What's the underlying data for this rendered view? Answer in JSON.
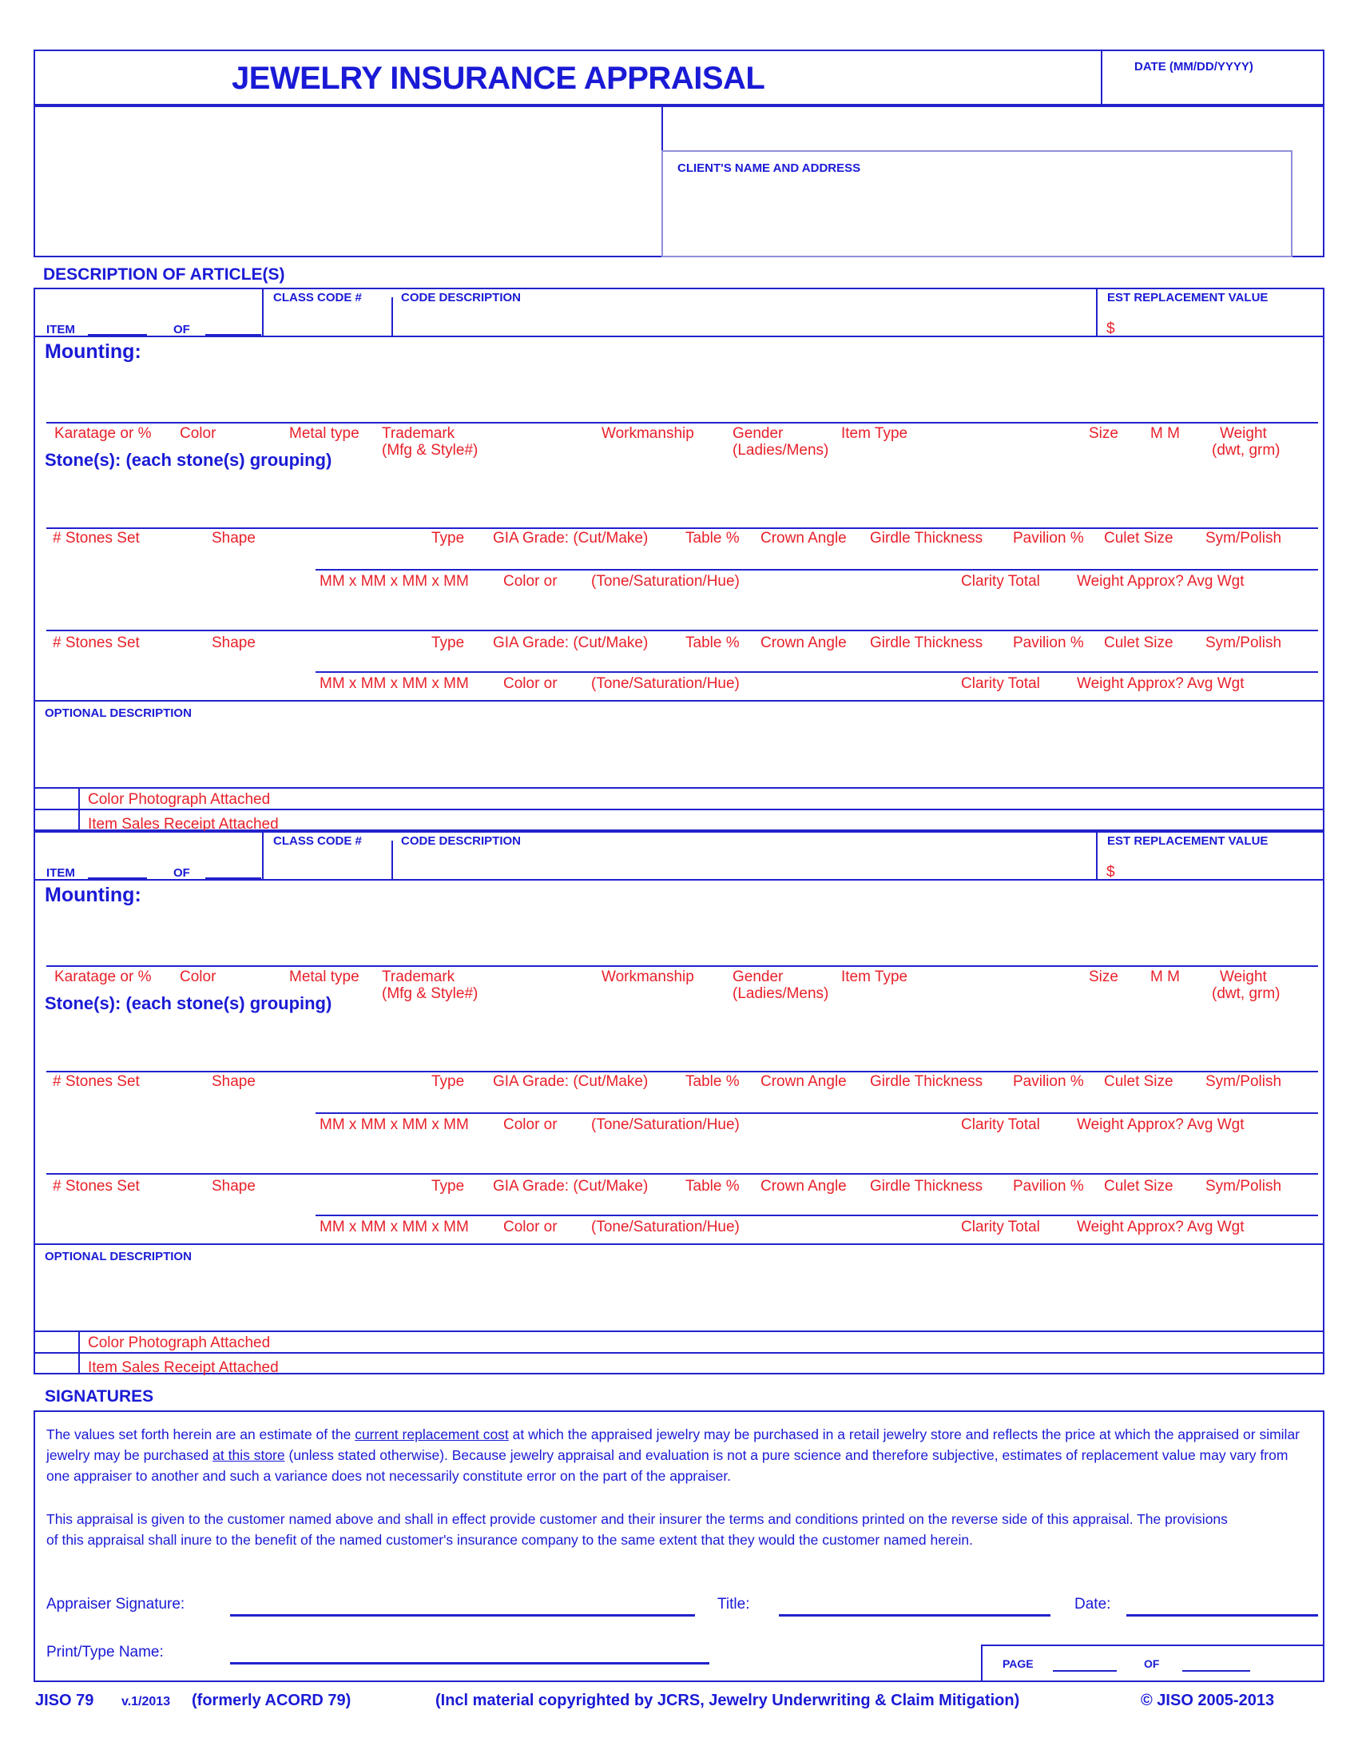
{
  "document": {
    "title": "JEWELRY INSURANCE APPRAISAL",
    "date_label": "DATE (MM/DD/YYYY)",
    "client_block_label": "CLIENT'S NAME AND ADDRESS",
    "description_section_label": "DESCRIPTION OF ARTICLE(S)",
    "signatures_section_label": "SIGNATURES"
  },
  "item_headers": {
    "item_label": "ITEM",
    "of_label": "OF",
    "class_code_label": "CLASS CODE #",
    "code_description_label": "CODE DESCRIPTION",
    "est_replacement_label": "EST REPLACEMENT VALUE",
    "dollar_sign": "$"
  },
  "mounting": {
    "heading": "Mounting:",
    "fields": [
      "Karatage  or  %",
      "Color",
      "Metal   type",
      "Trademark",
      "Workmanship",
      "Gender",
      "Item   Type",
      "Size",
      "M M",
      "Weight"
    ],
    "sub_trademark": "(Mfg  &  Style#)",
    "sub_gender": "(Ladies/Mens)",
    "sub_weight": "(dwt,  grm)"
  },
  "stones": {
    "heading": "Stone(s): (each stone(s) grouping)",
    "row_a_left": "#  Stones  Set",
    "row_a_shape": "Shape",
    "row_a_type": "Type",
    "row_a_gia": "GIA  Grade:  (Cut/Make)",
    "row_a_table": "Table   %",
    "row_a_crown": "Crown   Angle",
    "row_a_girdle": "Girdle   Thickness",
    "row_a_pavilion": "Pavilion   %",
    "row_a_culet": "Culet   Size",
    "row_a_sym": "Sym/Polish",
    "row_b_mm": "MM x MM x MM x MM",
    "row_b_color": "Color   or",
    "row_b_tone": "(Tone/Saturation/Hue)",
    "row_b_clarity": "Clarity   Total",
    "row_b_weight": "Weight  Approx?  Avg  Wgt"
  },
  "optional": {
    "label": "OPTIONAL DESCRIPTION",
    "checkbox_color_photo": "Color   Photograph   Attached",
    "checkbox_sales_receipt": "Item  Sales  Receipt  Attached"
  },
  "signatures": {
    "para1_part1": "The values set forth herein are an estimate of the ",
    "para1_u1": "current replacement cost",
    "para1_part2": " at which the appraised jewelry may be purchased in a retail jewelry store and reflects the price at which the appraised or similar jewelry may be purchased ",
    "para1_u2": "at this store",
    "para1_part3": " (unless stated otherwise). Because jewelry appraisal and evaluation is not a pure science and therefore subjective, estimates of replacement value may vary from one appraiser to another and such a variance does not necessarily constitute error on the part of the appraiser.",
    "para2": "This appraisal is given to the customer named above and shall in effect provide customer and their insurer the terms and conditions printed on the reverse side of this appraisal. The provisions of this appraisal shall inure to the benefit of the named customer's insurance company to the same extent that they would the customer named herein.",
    "appraiser_signature_label": "Appraiser   Signature:",
    "title_label": "Title:",
    "date_label": "Date:",
    "print_name_label": "Print/Type   Name:",
    "page_label": "PAGE",
    "page_of_label": "OF"
  },
  "footer": {
    "form_id": "JISO 79",
    "version": "v.1/2013",
    "formerly": "(formerly ACORD 79)",
    "copyright_note": "(Incl material copyrighted by JCRS, Jewelry Underwriting & Claim Mitigation)",
    "copyright": "© JISO 2005-2013"
  },
  "colors": {
    "blue": "#1a1ad6",
    "red": "#e8212b",
    "border": "#2222cc"
  }
}
